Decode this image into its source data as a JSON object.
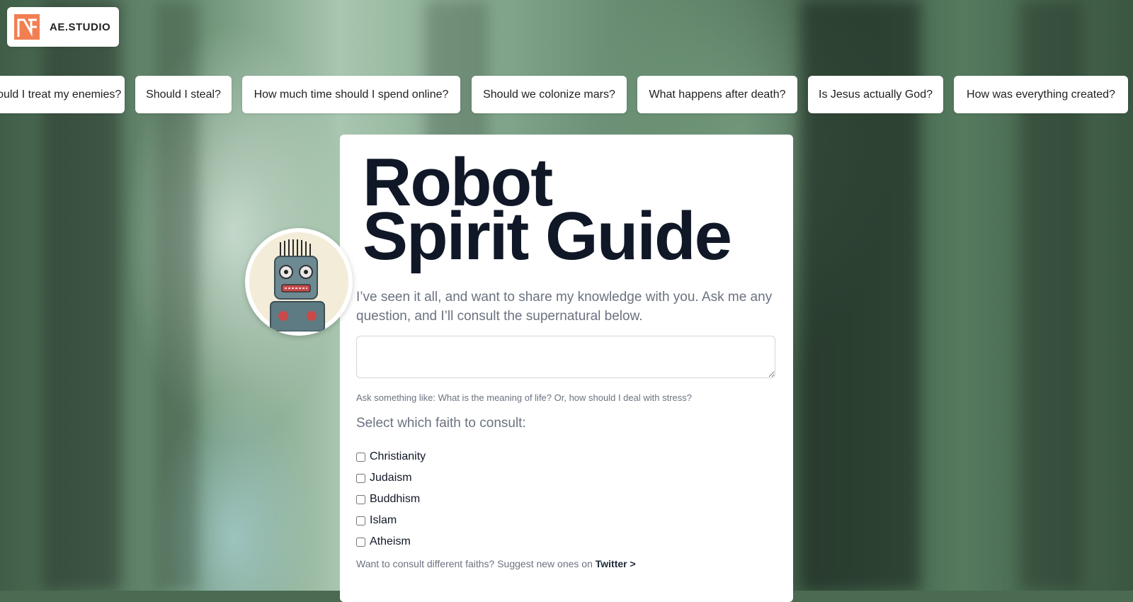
{
  "brand": {
    "name": "AE.STUDIO"
  },
  "chips": [
    "How should I treat my enemies?",
    "Should I steal?",
    "How much time should I spend online?",
    "Should we colonize mars?",
    "What happens after death?",
    "Is Jesus actually God?",
    "How was everything created?"
  ],
  "main": {
    "title_line1": "Robot",
    "title_line2": "Spirit Guide",
    "subtitle": "I’ve seen it all, and want to share my knowledge with you. Ask me any question, and I’ll consult the supernatural below.",
    "question_value": "",
    "hint": "Ask something like: What is the meaning of life? Or, how should I deal with stress?",
    "faith_title": "Select which faith to consult:",
    "faiths": [
      {
        "label": "Christianity",
        "checked": false
      },
      {
        "label": "Judaism",
        "checked": false
      },
      {
        "label": "Buddhism",
        "checked": false
      },
      {
        "label": "Islam",
        "checked": false
      },
      {
        "label": "Atheism",
        "checked": false
      }
    ],
    "suggest_text": "Want to consult different faiths? Suggest new ones on ",
    "suggest_link": "Twitter >"
  },
  "icons": {
    "logo": "ae-studio-logo-icon",
    "avatar": "robot-avatar"
  },
  "colors": {
    "logo_orange": "#f27f52",
    "title": "#101828",
    "muted": "#6b7280"
  }
}
